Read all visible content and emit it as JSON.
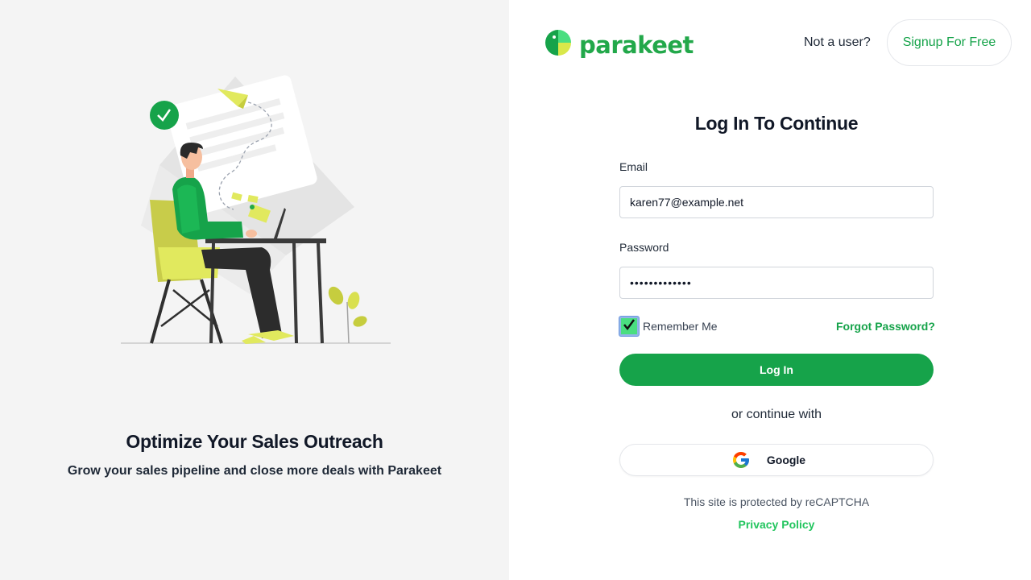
{
  "brand": {
    "name": "parakeet",
    "logo_icon": "parakeet-logo-icon",
    "accent_color": "#16a34a"
  },
  "hero": {
    "illustration": "person-at-laptop-sending-emails-illustration",
    "title": "Optimize Your Sales Outreach",
    "subtitle": "Grow your sales pipeline and close more deals with Parakeet"
  },
  "header": {
    "not_user_text": "Not a user?",
    "signup_label": "Signup For Free"
  },
  "form": {
    "title": "Log In To Continue",
    "email_label": "Email",
    "email_value": "karen77@example.net",
    "password_label": "Password",
    "password_value": "•••••••••••••",
    "remember_label": "Remember Me",
    "remember_checked": true,
    "forgot_label": "Forgot Password?",
    "login_label": "Log In",
    "or_text": "or continue with",
    "google_label": "Google",
    "recaptcha_text": "This site is protected by reCAPTCHA",
    "privacy_label": "Privacy Policy"
  }
}
